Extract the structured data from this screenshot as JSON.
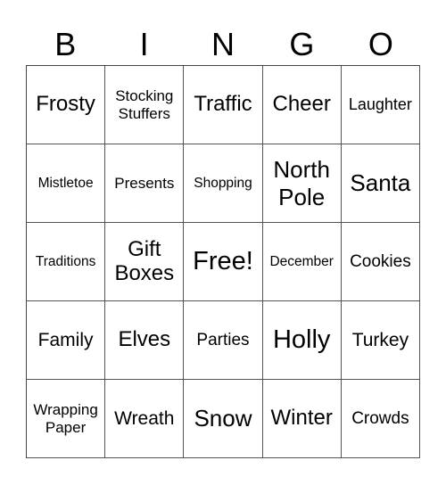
{
  "header": [
    "B",
    "I",
    "N",
    "G",
    "O"
  ],
  "cells": [
    [
      "Frosty",
      "Stocking Stuffers",
      "Traffic",
      "Cheer",
      "Laughter"
    ],
    [
      "Mistletoe",
      "Presents",
      "Shopping",
      "North Pole",
      "Santa"
    ],
    [
      "Traditions",
      "Gift Boxes",
      "Free!",
      "December",
      "Cookies"
    ],
    [
      "Family",
      "Elves",
      "Parties",
      "Holly",
      "Turkey"
    ],
    [
      "Wrapping Paper",
      "Wreath",
      "Snow",
      "Winter",
      "Crowds"
    ]
  ]
}
